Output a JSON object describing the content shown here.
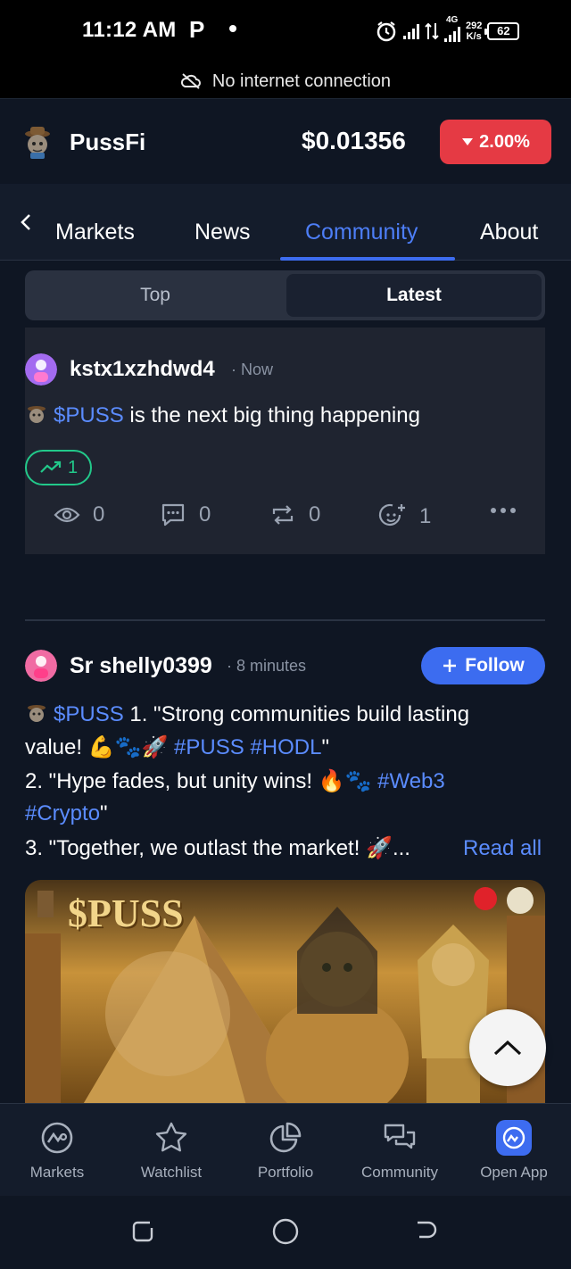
{
  "status_bar": {
    "time": "11:12 AM",
    "app_indicator": "P",
    "network_type": "4G",
    "net_speed_value": "292",
    "net_speed_unit": "K/s",
    "battery": "62"
  },
  "banner": {
    "text": "No internet connection",
    "icon": "cloud-off-icon"
  },
  "header": {
    "coin_name": "PussFi",
    "price": "$0.01356",
    "change": "2.00%",
    "change_direction": "down",
    "change_color": "#e53a44"
  },
  "tabs": [
    {
      "label": "Markets",
      "active": false
    },
    {
      "label": "News",
      "active": false
    },
    {
      "label": "Community",
      "active": true
    },
    {
      "label": "About",
      "active": false
    }
  ],
  "segment": {
    "top_label": "Top",
    "latest_label": "Latest",
    "selected": "Latest"
  },
  "post1": {
    "username": "kstx1xzhdwd4",
    "time": "· Now",
    "cashtag": "$PUSS",
    "text": " is the next big thing happening",
    "trend_count": "1",
    "views": "0",
    "comments": "0",
    "reposts": "0",
    "reactions": "1"
  },
  "post2": {
    "username": "Sr shelly0399",
    "time": "· 8 minutes",
    "follow_label": "Follow",
    "cashtag": "$PUSS",
    "line1_text": " 1. \"Strong communities build lasting",
    "line2_text": "value! 💪🐾🚀 ",
    "line2_tags": "#PUSS #HODL",
    "line2_end": "\"",
    "line3_text": "2. \"Hype fades, but unity wins! 🔥🐾 ",
    "line3_tag": "#Web3",
    "line4_tag": "#Crypto",
    "line4_end": "\"",
    "line5_text": "3. \"Together, we outlast the market! 🚀...",
    "read_all": "Read all",
    "image_title": "$PUSS"
  },
  "bottom_nav": [
    {
      "label": "Markets",
      "icon": "markets-logo-icon"
    },
    {
      "label": "Watchlist",
      "icon": "star-icon"
    },
    {
      "label": "Portfolio",
      "icon": "pie-chart-icon"
    },
    {
      "label": "Community",
      "icon": "chat-bubbles-icon"
    },
    {
      "label": "Open App",
      "icon": "app-logo-icon"
    }
  ],
  "colors": {
    "accent": "#3d6cf0",
    "link": "#5b8cff",
    "positive": "#22c98a",
    "negative": "#e53a44",
    "background": "#0f1623"
  }
}
